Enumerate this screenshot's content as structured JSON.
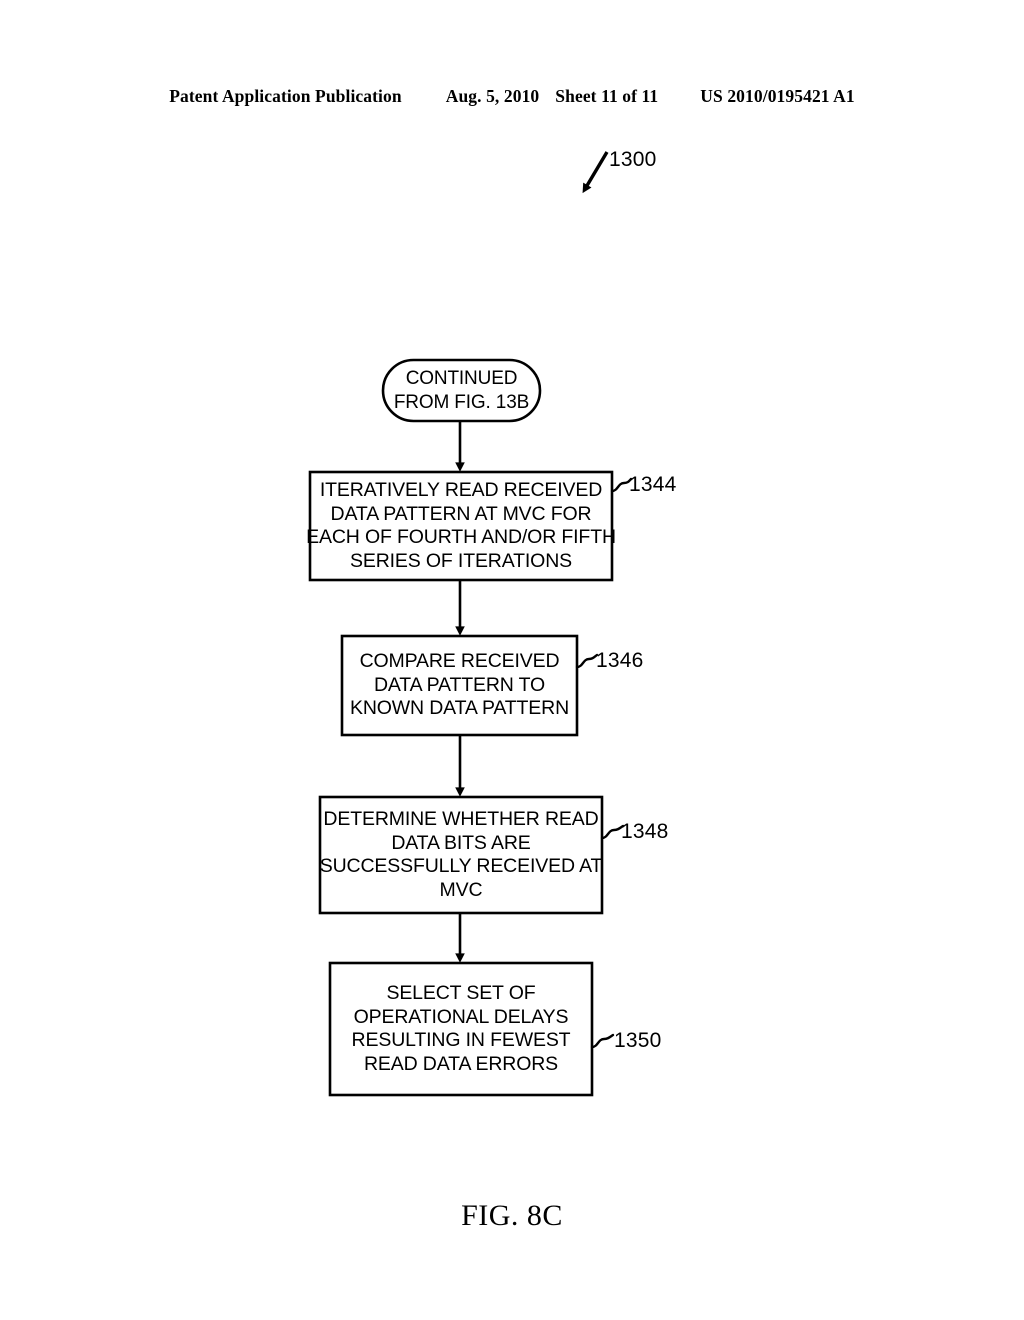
{
  "header": {
    "publication": "Patent Application Publication",
    "date": "Aug. 5, 2010",
    "sheet": "Sheet 11 of 11",
    "patent_number": "US 2010/0195421 A1"
  },
  "figure": {
    "caption": "FIG. 8C",
    "diagram_ref": "1300"
  },
  "flowchart": {
    "terminator": {
      "ref": "",
      "lines": [
        "CONTINUED",
        "FROM FIG. 13B"
      ]
    },
    "steps": [
      {
        "ref": "1344",
        "lines": [
          "ITERATIVELY READ RECEIVED",
          "DATA PATTERN AT MVC FOR",
          "EACH OF FOURTH AND/OR FIFTH",
          "SERIES OF ITERATIONS"
        ]
      },
      {
        "ref": "1346",
        "lines": [
          "COMPARE RECEIVED",
          "DATA PATTERN TO",
          "KNOWN DATA PATTERN"
        ]
      },
      {
        "ref": "1348",
        "lines": [
          "DETERMINE WHETHER READ",
          "DATA BITS ARE",
          "SUCCESSFULLY RECEIVED AT",
          "MVC"
        ]
      },
      {
        "ref": "1350",
        "lines": [
          "SELECT SET OF",
          "OPERATIONAL DELAYS",
          "RESULTING IN FEWEST",
          "READ DATA ERRORS"
        ]
      }
    ]
  },
  "style": {
    "ink": "#000000",
    "paper": "#ffffff"
  }
}
